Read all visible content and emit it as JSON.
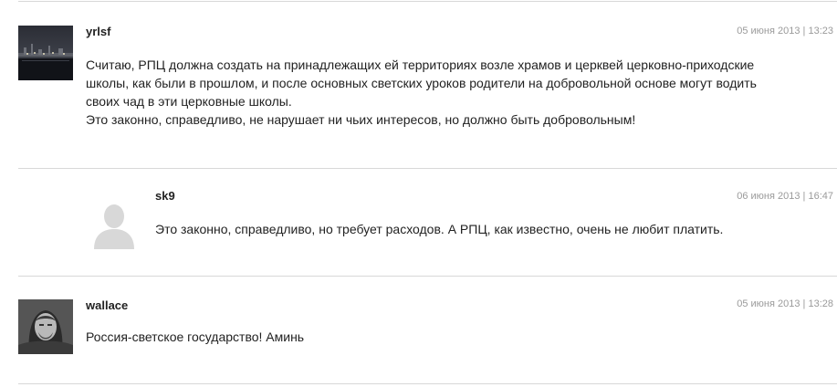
{
  "comments": [
    {
      "author": "yrlsf",
      "date": "05 июня 2013 | 13:23",
      "avatar_icon": "night-city-photo-avatar",
      "text_lines": [
        "Считаю, РПЦ должна создать на принадлежащих ей территориях возле храмов и церквей церковно-приходские",
        "школы, как были в прошлом, и после основных светских уроков родители на добровольной основе могут водить",
        "своих чад в эти церковные школы.",
        "Это законно, справедливо, не нарушает ни чьих интересов, но должно быть добровольным!"
      ]
    },
    {
      "author": "sk9",
      "date": "06 июня 2013 | 16:47",
      "avatar_icon": "default-user-avatar",
      "text_lines": [
        "Это законно, справедливо, но требует расходов. А РПЦ, как известно, очень не любит платить."
      ]
    },
    {
      "author": "wallace",
      "date": "05 июня 2013 | 13:28",
      "avatar_icon": "portrait-photo-avatar",
      "text_lines": [
        "Россия-светское государство! Аминь"
      ]
    }
  ]
}
